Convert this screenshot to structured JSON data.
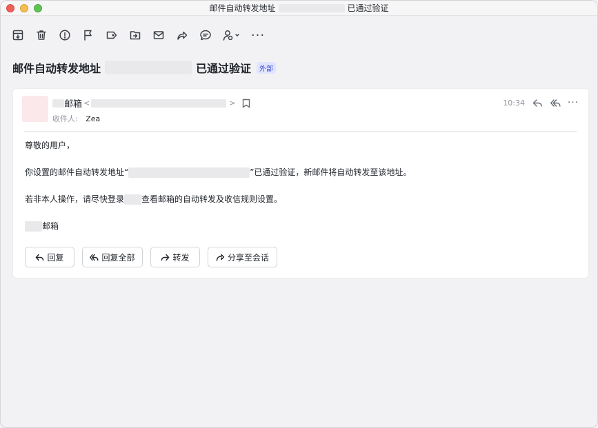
{
  "window": {
    "title_prefix": "邮件自动转发地址",
    "title_suffix": "已通过验证"
  },
  "toolbar": {
    "items": [
      {
        "icon": "archive-icon"
      },
      {
        "icon": "trash-icon"
      },
      {
        "icon": "spam-icon"
      },
      {
        "icon": "flag-icon"
      },
      {
        "icon": "label-icon"
      },
      {
        "icon": "move-folder-icon"
      },
      {
        "icon": "mark-read-icon"
      },
      {
        "icon": "share-icon"
      },
      {
        "icon": "comment-icon"
      },
      {
        "icon": "contact-settings-icon"
      },
      {
        "icon": "more-icon"
      }
    ],
    "more_label": "···"
  },
  "subject": {
    "prefix": "邮件自动转发地址",
    "suffix": "已通过验证",
    "badge": "外部"
  },
  "message": {
    "sender_name": "邮箱",
    "sender_addr_open": "<",
    "sender_addr_close": ">",
    "recipient_label": "收件人:",
    "recipient_name": "Zea",
    "time": "10:34",
    "more_label": "···",
    "body": {
      "greeting": "尊敬的用户，",
      "line1_prefix": "你设置的邮件自动转发地址“",
      "line1_suffix": "”已通过验证，新邮件将自动转发至该地址。",
      "line2_prefix": "若非本人操作，请尽快登录",
      "line2_suffix": "查看邮箱的自动转发及收信规则设置。",
      "signature": "邮箱"
    }
  },
  "actions": {
    "reply": "回复",
    "reply_all": "回复全部",
    "forward": "转发",
    "share": "分享至会话"
  }
}
